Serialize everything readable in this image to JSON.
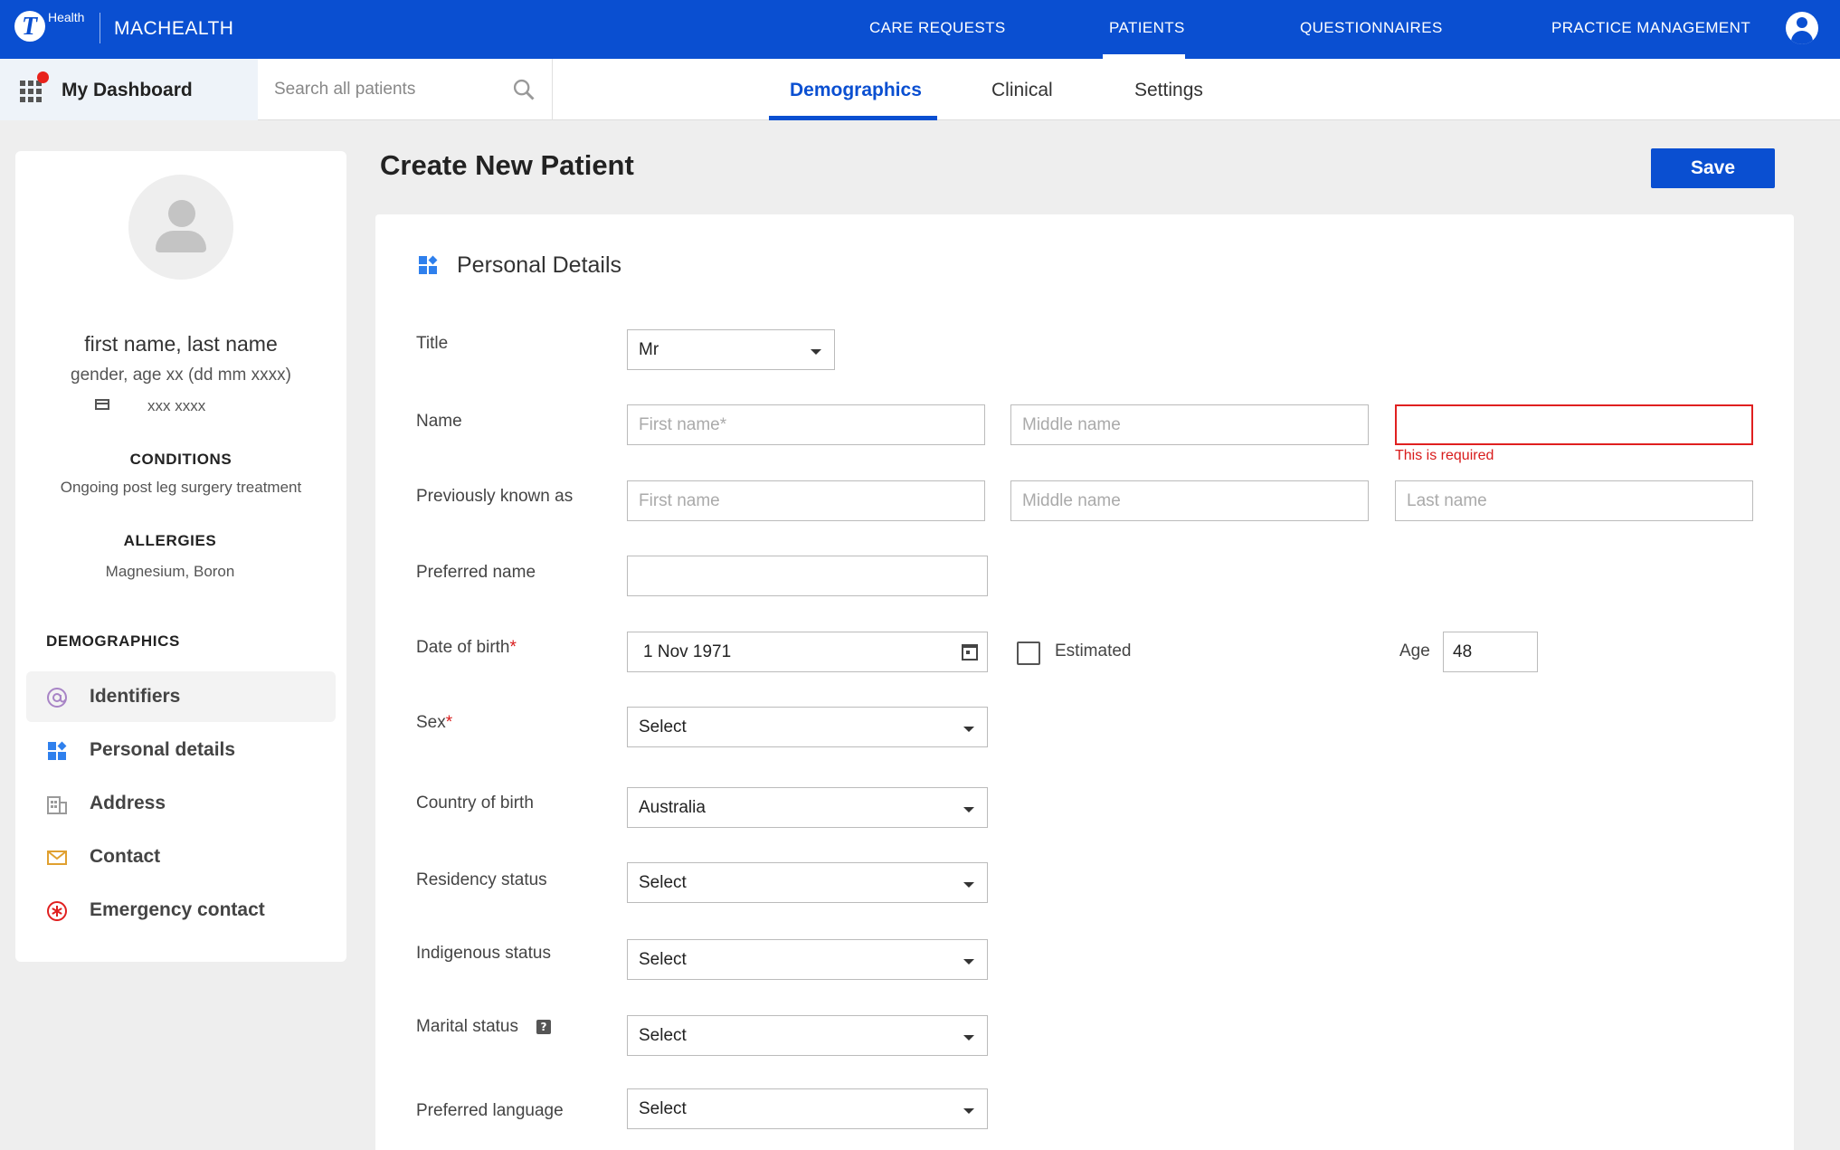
{
  "app": {
    "logo_letter": "T",
    "logo_sub": "Health",
    "brand": "MACHEALTH",
    "brand_color": "#0a4fd1"
  },
  "nav": {
    "items": [
      "CARE REQUESTS",
      "PATIENTS",
      "QUESTIONNAIRES",
      "PRACTICE MANAGEMENT"
    ],
    "active": "PATIENTS"
  },
  "subbar": {
    "dashboard_label": "My Dashboard",
    "search_placeholder": "Search all patients",
    "tabs": [
      "Demographics",
      "Clinical",
      "Settings"
    ],
    "active_tab": "Demographics"
  },
  "profile": {
    "name": "first name, last name",
    "subtitle": "gender, age xx (dd mm xxxx)",
    "id_value": "xxx xxxx",
    "conditions_heading": "CONDITIONS",
    "conditions": "Ongoing post leg surgery treatment",
    "allergies_heading": "ALLERGIES",
    "allergies": "Magnesium, Boron",
    "demographics_heading": "DEMOGRAPHICS",
    "menu": [
      {
        "label": "Identifiers",
        "icon": "at-icon",
        "active": true
      },
      {
        "label": "Personal details",
        "icon": "widgets-icon"
      },
      {
        "label": "Address",
        "icon": "building-icon"
      },
      {
        "label": "Contact",
        "icon": "mail-icon"
      },
      {
        "label": "Emergency contact",
        "icon": "emergency-icon"
      }
    ]
  },
  "page": {
    "title": "Create New Patient",
    "save_label": "Save",
    "section_title": "Personal Details"
  },
  "form": {
    "title": {
      "label": "Title",
      "value": "Mr"
    },
    "name": {
      "label": "Name",
      "first_placeholder": "First name*",
      "middle_placeholder": "Middle name",
      "last_value": "",
      "error": "This is required"
    },
    "previously_known_as": {
      "label": "Previously known as",
      "first_placeholder": "First name",
      "middle_placeholder": "Middle name",
      "last_placeholder": "Last name"
    },
    "preferred_name": {
      "label": "Preferred name",
      "value": ""
    },
    "dob": {
      "label": "Date of birth",
      "required_mark": "*",
      "value": "1 Nov 1971",
      "estimated_label": "Estimated",
      "estimated_checked": false,
      "age_label": "Age",
      "age_value": "48"
    },
    "sex": {
      "label": "Sex",
      "required_mark": "*",
      "value": "Select"
    },
    "country_of_birth": {
      "label": "Country of birth",
      "value": "Australia"
    },
    "residency_status": {
      "label": "Residency status",
      "value": "Select"
    },
    "indigenous_status": {
      "label": "Indigenous status",
      "value": "Select"
    },
    "marital_status": {
      "label": "Marital status",
      "help_glyph": "?",
      "value": "Select"
    },
    "preferred_language": {
      "label": "Preferred language",
      "value": "Select"
    }
  }
}
